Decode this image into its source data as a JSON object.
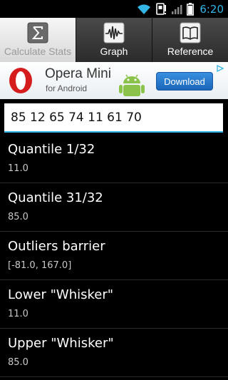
{
  "status_bar": {
    "time": "6:20",
    "icons": [
      "wifi-icon",
      "sim-card-icon",
      "signal-icon",
      "battery-icon"
    ],
    "accent_color": "#33b5e5"
  },
  "tabs": [
    {
      "label": "Calculate Stats",
      "icon": "sigma-icon",
      "selected": true
    },
    {
      "label": "Graph",
      "icon": "waveform-icon",
      "selected": false
    },
    {
      "label": "Reference",
      "icon": "book-icon",
      "selected": false
    }
  ],
  "ad": {
    "title": "Opera Mini",
    "subtitle": "for Android",
    "button_label": "Download",
    "logo": "opera-logo",
    "mascot": "android-robot-icon",
    "info_icon": "ad-info-icon"
  },
  "input": {
    "value": "85 12 65 74 11 61 70",
    "placeholder": ""
  },
  "results": [
    {
      "title": "Quantile 1/32",
      "value": "11.0"
    },
    {
      "title": "Quantile 31/32",
      "value": "85.0"
    },
    {
      "title": "Outliers barrier",
      "value": "[-81.0, 167.0]"
    },
    {
      "title": "Lower \"Whisker\"",
      "value": "11.0"
    },
    {
      "title": "Upper \"Whisker\"",
      "value": "85.0"
    }
  ]
}
